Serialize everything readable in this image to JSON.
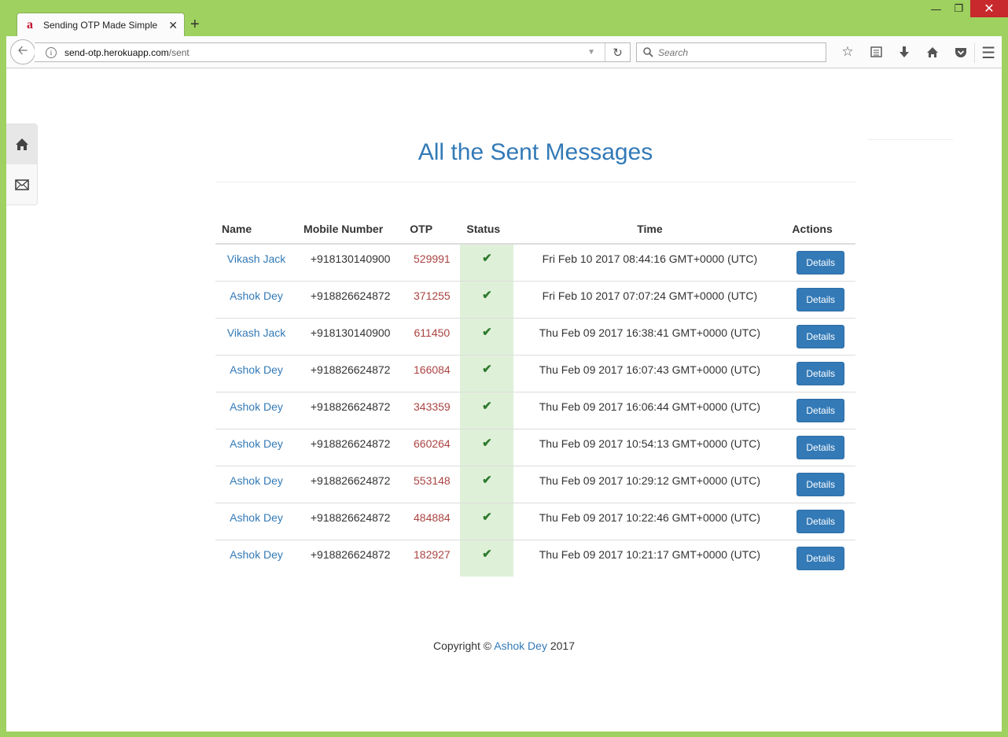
{
  "browser": {
    "tab_title": "Sending OTP Made Simple",
    "favicon": "a",
    "new_tab": "+",
    "url_host": "send-otp.herokuapp.com",
    "url_path": "/sent",
    "search_placeholder": "Search",
    "icons": [
      "back-icon",
      "info-icon",
      "reload-icon",
      "search-icon",
      "bookmark-star-icon",
      "reading-list-icon",
      "download-icon",
      "home-icon",
      "pocket-icon",
      "menu-icon"
    ]
  },
  "sidenav": {
    "items": [
      {
        "icon": "home-icon"
      },
      {
        "icon": "envelope-icon"
      }
    ]
  },
  "page": {
    "title": "All the Sent Messages",
    "columns": [
      "Name",
      "Mobile Number",
      "OTP",
      "Status",
      "Time",
      "Actions"
    ],
    "status_icon": "✔",
    "action_label": "Details",
    "rows": [
      {
        "name": "Vikash Jack",
        "mobile": "+918130140900",
        "otp": "529991",
        "time": "Fri Feb 10 2017 08:44:16 GMT+0000 (UTC)"
      },
      {
        "name": "Ashok Dey",
        "mobile": "+918826624872",
        "otp": "371255",
        "time": "Fri Feb 10 2017 07:07:24 GMT+0000 (UTC)"
      },
      {
        "name": "Vikash Jack",
        "mobile": "+918130140900",
        "otp": "611450",
        "time": "Thu Feb 09 2017 16:38:41 GMT+0000 (UTC)"
      },
      {
        "name": "Ashok Dey",
        "mobile": "+918826624872",
        "otp": "166084",
        "time": "Thu Feb 09 2017 16:07:43 GMT+0000 (UTC)"
      },
      {
        "name": "Ashok Dey",
        "mobile": "+918826624872",
        "otp": "343359",
        "time": "Thu Feb 09 2017 16:06:44 GMT+0000 (UTC)"
      },
      {
        "name": "Ashok Dey",
        "mobile": "+918826624872",
        "otp": "660264",
        "time": "Thu Feb 09 2017 10:54:13 GMT+0000 (UTC)"
      },
      {
        "name": "Ashok Dey",
        "mobile": "+918826624872",
        "otp": "553148",
        "time": "Thu Feb 09 2017 10:29:12 GMT+0000 (UTC)"
      },
      {
        "name": "Ashok Dey",
        "mobile": "+918826624872",
        "otp": "484884",
        "time": "Thu Feb 09 2017 10:22:46 GMT+0000 (UTC)"
      },
      {
        "name": "Ashok Dey",
        "mobile": "+918826624872",
        "otp": "182927",
        "time": "Thu Feb 09 2017 10:21:17 GMT+0000 (UTC)"
      }
    ]
  },
  "footer": {
    "prefix": "Copyright ©",
    "author": "Ashok Dey",
    "year": "2017"
  },
  "colors": {
    "frame": "#9ed15f",
    "link": "#337ab7",
    "otp": "#a94442",
    "status_bg": "#dff0d8",
    "status_check": "#2d7a2d",
    "close_button": "#c7292d"
  }
}
